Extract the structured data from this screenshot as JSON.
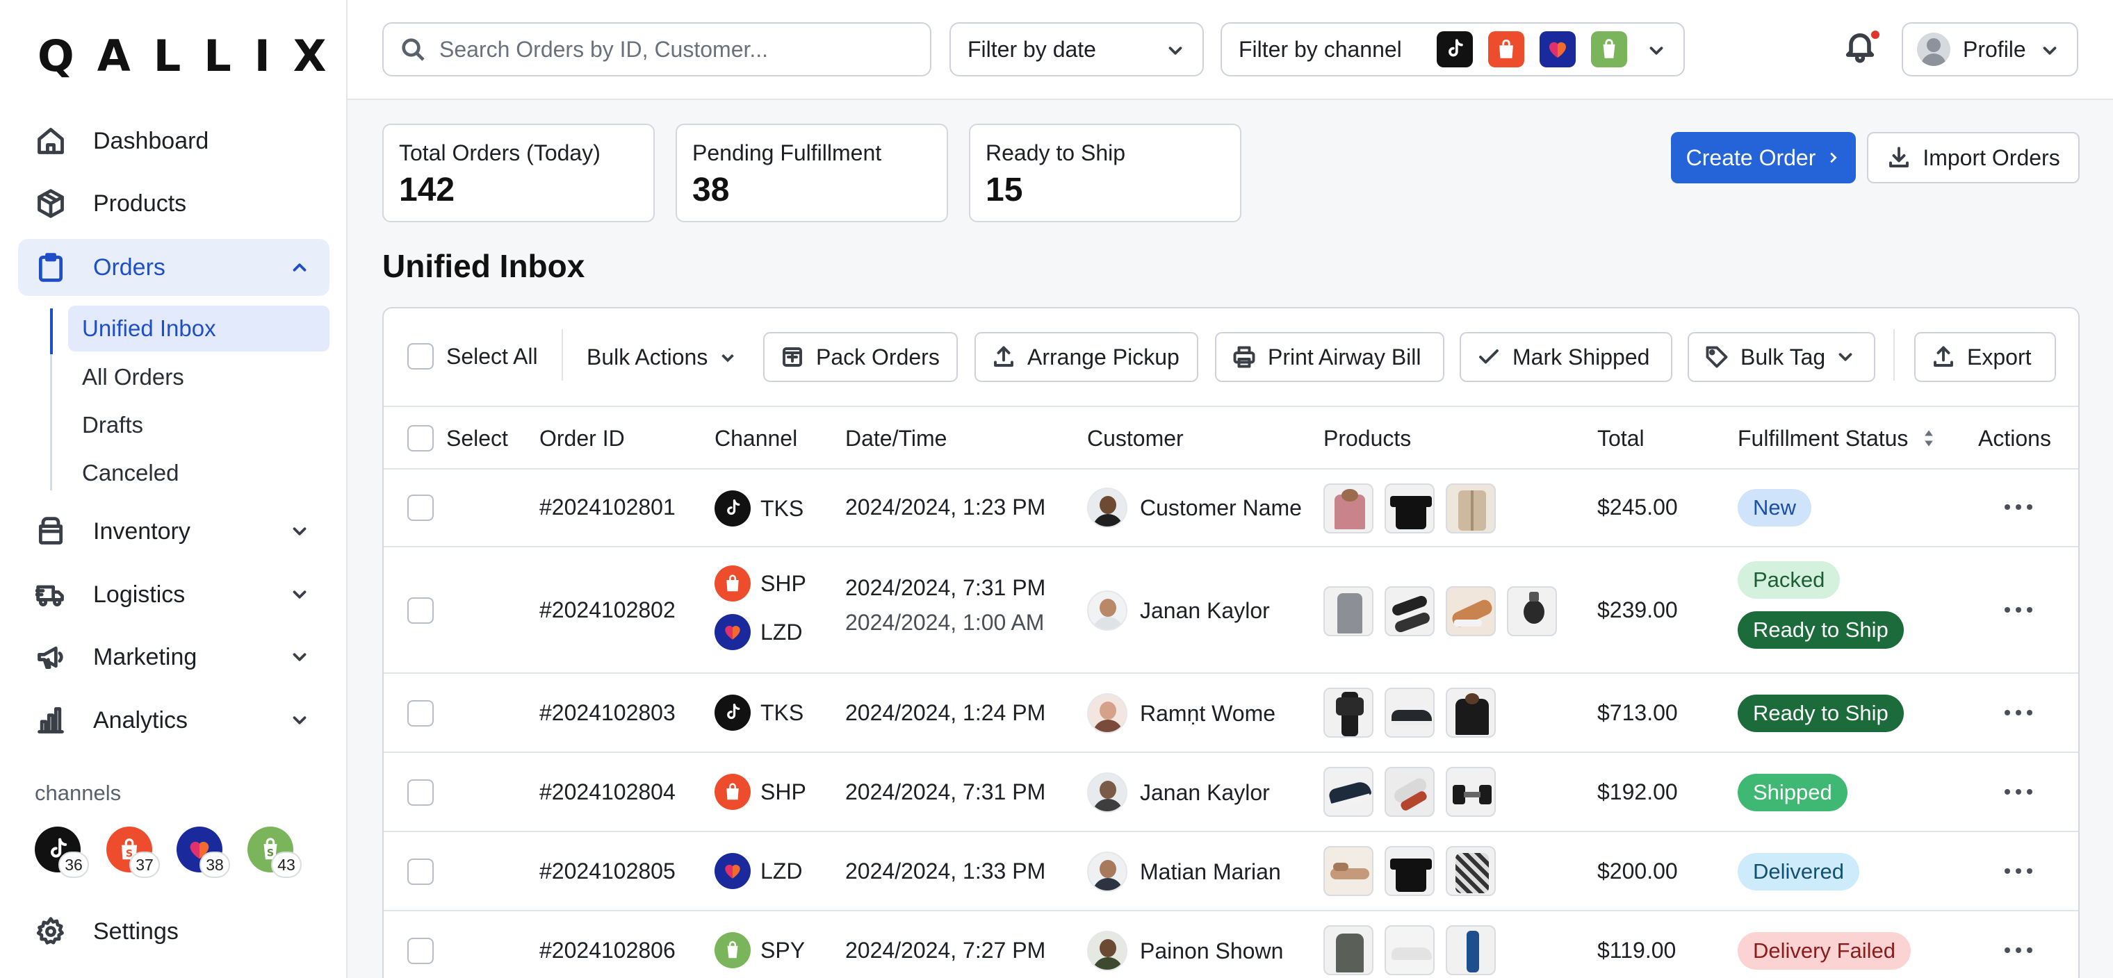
{
  "app": {
    "logo_text": "QALLIX"
  },
  "sidebar": {
    "items": [
      {
        "label": "Dashboard",
        "icon": "home-icon"
      },
      {
        "label": "Products",
        "icon": "box-icon"
      },
      {
        "label": "Orders",
        "icon": "clipboard-icon",
        "expanded": true
      },
      {
        "label": "Inventory",
        "icon": "archive-icon"
      },
      {
        "label": "Logistics",
        "icon": "truck-icon"
      },
      {
        "label": "Marketing",
        "icon": "megaphone-icon"
      },
      {
        "label": "Analytics",
        "icon": "bar-chart-icon"
      }
    ],
    "order_sub_items": [
      {
        "label": "Unified Inbox",
        "active": true
      },
      {
        "label": "All Orders"
      },
      {
        "label": "Drafts"
      },
      {
        "label": "Canceled"
      }
    ],
    "channels_title": "channels",
    "channels": [
      {
        "name": "TikTok Shop",
        "count": "36",
        "color": "#111111"
      },
      {
        "name": "Shopee",
        "count": "37",
        "color": "#ee4d2d"
      },
      {
        "name": "Lazada",
        "count": "38",
        "color": "#1a2a9c"
      },
      {
        "name": "Shopify",
        "count": "43",
        "color": "#7ab55c"
      }
    ],
    "settings_label": "Settings"
  },
  "topbar": {
    "search_placeholder": "Search Orders by ID, Customer...",
    "date_filter": "Filter by date",
    "channel_filter": "Filter by channel",
    "profile_label": "Profile",
    "notification_unread": true
  },
  "stats": [
    {
      "label": "Total Orders (Today)",
      "value": "142"
    },
    {
      "label": "Pending Fulfillment",
      "value": "38"
    },
    {
      "label": "Ready to Ship",
      "value": "15"
    }
  ],
  "actions": {
    "create": "Create Order",
    "import": "Import Orders"
  },
  "inbox": {
    "title": "Unified Inbox",
    "toolbar": {
      "select_all": "Select All",
      "bulk_actions": "Bulk Actions",
      "pack": "Pack Orders",
      "pickup": "Arrange Pickup",
      "print": "Print Airway Bill",
      "shipped": "Mark Shipped",
      "tag": "Bulk Tag",
      "export": "Export"
    },
    "columns": [
      "Select",
      "Order ID",
      "Channel",
      "Date/Time",
      "Customer",
      "Products",
      "Total",
      "Fulfillment Status",
      "Actions"
    ],
    "rows": [
      {
        "id": "#2024102801",
        "channels": [
          "TKS"
        ],
        "dates": [
          "2024/2024, 1:23 PM"
        ],
        "customer": "Customer Name",
        "total": "$245.00",
        "statuses": [
          "New"
        ]
      },
      {
        "id": "#2024102802",
        "channels": [
          "SHP",
          "LZD"
        ],
        "dates": [
          "2024/2024, 7:31 PM",
          "2024/2024, 1:00 AM"
        ],
        "customer": "Janan Kaylor",
        "total": "$239.00",
        "statuses": [
          "Packed",
          "Ready to Ship"
        ]
      },
      {
        "id": "#2024102803",
        "channels": [
          "TKS"
        ],
        "dates": [
          "2024/2024, 1:24 PM"
        ],
        "customer": "Ramṇt Wome",
        "total": "$713.00",
        "statuses": [
          "Ready to Ship"
        ]
      },
      {
        "id": "#2024102804",
        "channels": [
          "SHP"
        ],
        "dates": [
          "2024/2024, 7:31 PM"
        ],
        "customer": "Janan Kaylor",
        "total": "$192.00",
        "statuses": [
          "Shipped"
        ]
      },
      {
        "id": "#2024102805",
        "channels": [
          "LZD"
        ],
        "dates": [
          "2024/2024, 1:33 PM"
        ],
        "customer": "Matian Marian",
        "total": "$200.00",
        "statuses": [
          "Delivered"
        ]
      },
      {
        "id": "#2024102806",
        "channels": [
          "SPY"
        ],
        "dates": [
          "2024/2024, 7:27 PM"
        ],
        "customer": "Painon Shown",
        "total": "$119.00",
        "statuses": [
          "Delivery Failed"
        ]
      }
    ]
  },
  "colors": {
    "accent": "#2563d8",
    "status_new": "#cfe3fb",
    "status_packed": "#d3f1dc",
    "status_ready": "#1c6b3a",
    "status_shipped": "#3fb873",
    "status_delivered": "#cdebfa",
    "status_failed": "#fbd3d3"
  }
}
